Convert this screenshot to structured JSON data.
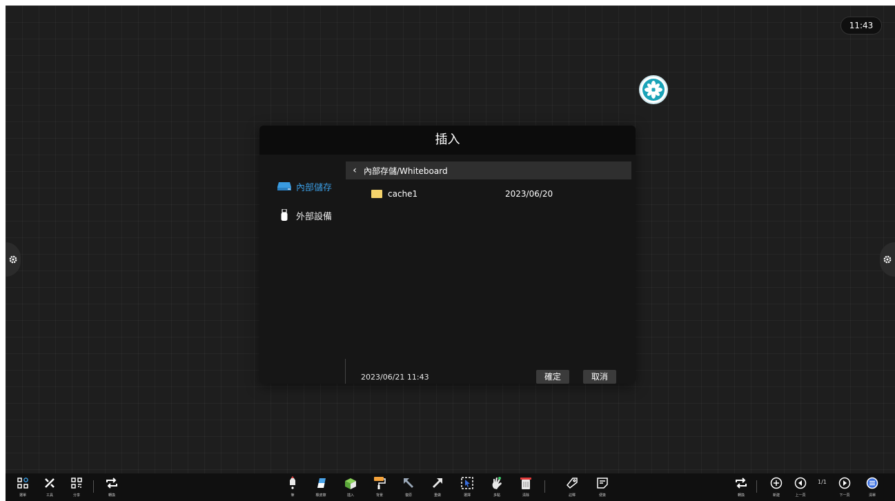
{
  "clock": "11:43",
  "dialog": {
    "title": "插入",
    "sources": [
      {
        "label": "內部儲存",
        "icon": "hard-drive-icon",
        "active": true
      },
      {
        "label": "外部設備",
        "icon": "usb-drive-icon",
        "active": false
      }
    ],
    "path": "內部存儲/Whiteboard",
    "files": [
      {
        "name": "cache1",
        "date": "2023/06/20",
        "icon": "folder-icon"
      }
    ],
    "footer_datetime": "2023/06/21 11:43",
    "confirm_label": "確定",
    "cancel_label": "取消"
  },
  "toolbar": {
    "left": [
      {
        "label": "選單",
        "icon": "menu-grid-icon"
      },
      {
        "label": "工具",
        "icon": "tools-icon"
      },
      {
        "label": "分享",
        "icon": "qr-code-icon"
      },
      {
        "label": "轉換",
        "icon": "switch-icon"
      }
    ],
    "center": [
      {
        "label": "筆",
        "icon": "pen-icon"
      },
      {
        "label": "橡皮擦",
        "icon": "eraser-icon"
      },
      {
        "label": "插入",
        "icon": "insert-icon"
      },
      {
        "label": "背景",
        "icon": "background-roller-icon"
      },
      {
        "label": "復原",
        "icon": "undo-icon"
      },
      {
        "label": "重做",
        "icon": "redo-icon"
      },
      {
        "label": "選擇",
        "icon": "select-icon"
      },
      {
        "label": "多點",
        "icon": "multi-touch-icon"
      },
      {
        "label": "清除",
        "icon": "clear-icon"
      },
      {
        "label": "註釋",
        "icon": "annotate-icon"
      },
      {
        "label": "便簽",
        "icon": "sticky-note-icon"
      }
    ],
    "right": [
      {
        "label": "轉換",
        "icon": "switch-icon"
      },
      {
        "label": "新建",
        "icon": "add-page-icon"
      },
      {
        "label": "上一頁",
        "icon": "prev-page-icon"
      },
      {
        "label": "下一頁",
        "icon": "next-page-icon"
      },
      {
        "label": "清單",
        "icon": "page-list-icon"
      }
    ],
    "page_indicator": "1/1"
  },
  "colors": {
    "background": "#1e1e1e",
    "accent": "#3a9be0",
    "folder": "#f4d36b",
    "float_button": "#1aa3b8"
  }
}
